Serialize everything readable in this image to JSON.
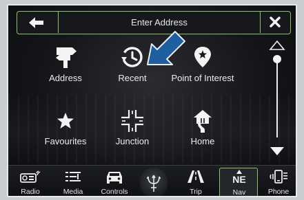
{
  "header": {
    "title": "Enter Address",
    "back_icon": "arrow-left-icon",
    "close_icon": "close-icon"
  },
  "grid": [
    {
      "id": "address",
      "label": "Address",
      "icon": "signpost-icon"
    },
    {
      "id": "recent",
      "label": "Recent",
      "icon": "clock-history-icon"
    },
    {
      "id": "poi",
      "label": "Point of Interest",
      "icon": "map-pin-star-icon"
    },
    {
      "id": "favourites",
      "label": "Favourites",
      "icon": "star-icon"
    },
    {
      "id": "junction",
      "label": "Junction",
      "icon": "crossroads-icon"
    },
    {
      "id": "home",
      "label": "Home",
      "icon": "home-road-icon"
    }
  ],
  "bottom_nav": [
    {
      "id": "radio",
      "label": "Radio",
      "icon": "radio-icon"
    },
    {
      "id": "media",
      "label": "Media",
      "icon": "media-icon"
    },
    {
      "id": "controls",
      "label": "Controls",
      "icon": "car-controls-icon"
    },
    {
      "id": "trip",
      "label": "Trip",
      "icon": "road-icon"
    },
    {
      "id": "nav",
      "label": "Nav",
      "icon": "compass-icon",
      "compass_text": "NE",
      "active": true
    },
    {
      "id": "phone",
      "label": "Phone",
      "icon": "phone-icon"
    }
  ],
  "center_logo": "trident-logo-icon",
  "colors": {
    "accent_green": "#8fc36b",
    "callout_arrow": "#1f5fa0",
    "background": "#141518"
  }
}
